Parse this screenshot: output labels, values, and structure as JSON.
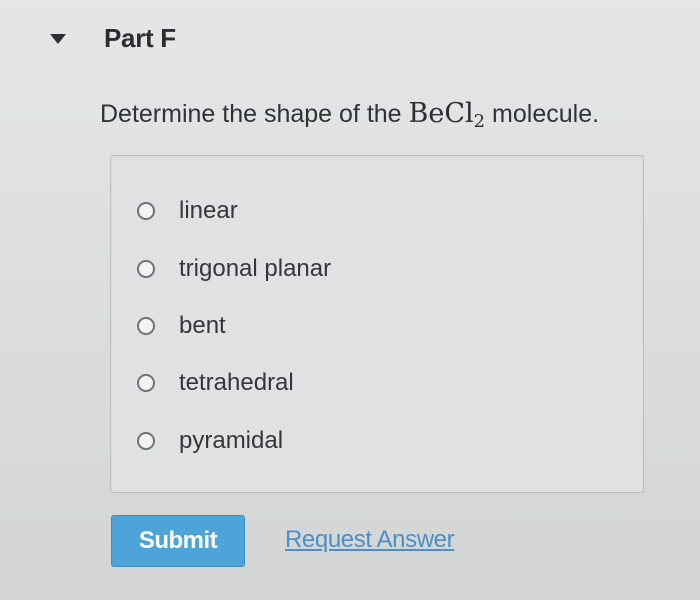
{
  "part": {
    "title": "Part F",
    "collapse_icon": "caret-down-icon"
  },
  "question": {
    "prefix": "Determine the shape of the ",
    "formula_main": "BeCl",
    "formula_sub": "2",
    "suffix": " molecule."
  },
  "options": [
    {
      "label": "linear",
      "selected": false
    },
    {
      "label": "trigonal planar",
      "selected": false
    },
    {
      "label": "bent",
      "selected": false
    },
    {
      "label": "tetrahedral",
      "selected": false
    },
    {
      "label": "pyramidal",
      "selected": false
    }
  ],
  "actions": {
    "submit_label": "Submit",
    "request_answer_label": "Request Answer"
  },
  "colors": {
    "submit_bg": "#4ca4d8",
    "link": "#4b8fc6"
  }
}
